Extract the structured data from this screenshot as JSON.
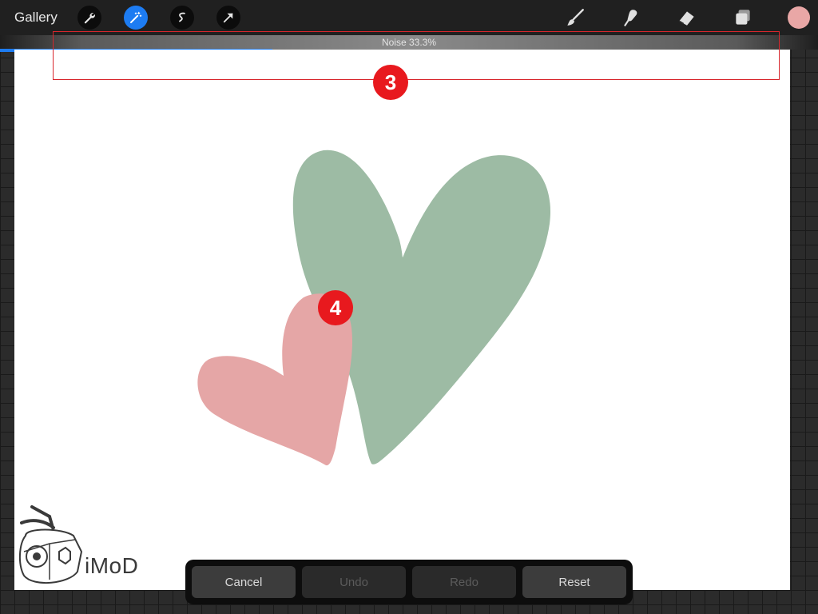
{
  "header": {
    "gallery_label": "Gallery",
    "left_tools": [
      {
        "icon": "wrench-icon",
        "active": false
      },
      {
        "icon": "magic-wand-icon",
        "active": true
      },
      {
        "icon": "selection-icon",
        "active": false
      },
      {
        "icon": "transform-arrow-icon",
        "active": false
      }
    ],
    "right_tools": [
      "brush-icon",
      "smudge-icon",
      "eraser-icon",
      "layers-icon"
    ],
    "current_color": "#e9a7a6"
  },
  "adjustment": {
    "label": "Noise 33.3%",
    "value_fraction": 0.333
  },
  "annotations": {
    "markers": [
      {
        "label": "3"
      },
      {
        "label": "4"
      }
    ],
    "accent": "#e8191e"
  },
  "artwork": {
    "large_heart_color": "#9dbba4",
    "small_heart_color": "#e5a6a6"
  },
  "watermark": {
    "text": "iMoD"
  },
  "actions": {
    "cancel": "Cancel",
    "undo": "Undo",
    "redo": "Redo",
    "reset": "Reset"
  }
}
